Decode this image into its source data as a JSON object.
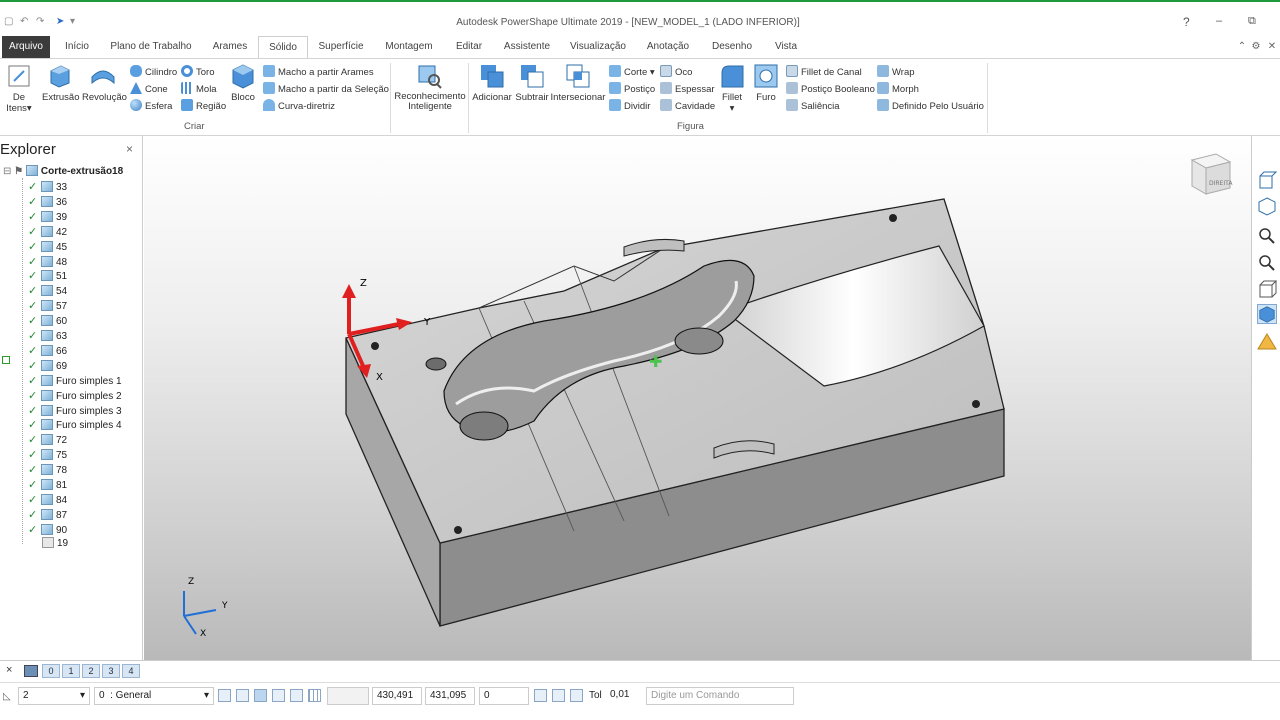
{
  "window": {
    "title": "Autodesk PowerShape Ultimate 2019 - [NEW_MODEL_1 (LADO INFERIOR)]",
    "help": "?",
    "minimize": "–",
    "maximize": "⧉",
    "close": "✕",
    "ribbon_collapse": "⌃",
    "ribbon_settings": "⚙",
    "ribbon_close": "✕"
  },
  "tabs": [
    "Arquivo",
    "Início",
    "Plano de Trabalho",
    "Arames",
    "Sólido",
    "Superfície",
    "Montagem",
    "Editar",
    "Assistente",
    "Visualização",
    "Anotação",
    "Desenho",
    "Vista"
  ],
  "active_tab": "Sólido",
  "ribbon": {
    "criar": {
      "label": "Criar",
      "de_itens": "De Itens",
      "extrusao": "Extrusão",
      "revolucao": "Revolução",
      "cilindro": "Cilindro",
      "cone": "Cone",
      "esfera": "Esfera",
      "toro": "Toro",
      "mola": "Mola",
      "regiao": "Região",
      "bloco": "Bloco",
      "macho_arames": "Macho a partir Arames",
      "macho_selecao": "Macho a partir da Seleção",
      "curva_diretriz": "Curva-diretriz"
    },
    "reconhecimento": "Reconhecimento Inteligente",
    "figura": {
      "label": "Figura",
      "adicionar": "Adicionar",
      "subtrair": "Subtrair",
      "intersecionar": "Intersecionar",
      "corte": "Corte",
      "postico": "Postiço",
      "dividir": "Dividir",
      "oco": "Oco",
      "espessar": "Espessar",
      "cavidade": "Cavidade",
      "fillet": "Fillet",
      "furo": "Furo",
      "fillet_canal": "Fillet de Canal",
      "postico_booleano": "Postiço Booleano",
      "saliencia": "Saliência",
      "wrap": "Wrap",
      "morph": "Morph",
      "definido_usuario": "Definido Pelo Usuário"
    }
  },
  "explorer": {
    "title": "Explorer",
    "close": "×",
    "root": "Corte-extrusão18",
    "items": [
      "33",
      "36",
      "39",
      "42",
      "45",
      "48",
      "51",
      "54",
      "57",
      "60",
      "63",
      "66",
      "69",
      "Furo simples 1",
      "Furo simples 2",
      "Furo simples 3",
      "Furo simples 4",
      "72",
      "75",
      "78",
      "81",
      "84",
      "87",
      "90"
    ],
    "last_item": "19"
  },
  "viewport": {
    "axis_z": "Z",
    "axis_y": "Y",
    "axis_x": "X",
    "mini_z": "Z",
    "mini_y": "Y",
    "mini_x": "X",
    "viewcube_label": "DIREITA"
  },
  "layers": {
    "close": "×",
    "items": [
      "0",
      "1",
      "2",
      "3",
      "4"
    ]
  },
  "status": {
    "level": "2",
    "layer": "0",
    "layer_name": ": General",
    "x": "430,491",
    "y": "431,095",
    "z": "0",
    "tol_label": "Tol",
    "tol": "0,01",
    "command_placeholder": "Digite um Comando"
  },
  "colors": {
    "accent": "#1e9a3c",
    "file_tab": "#3b3b3b",
    "icon_blue": "#4a90d9",
    "part_gray": "#8a8a8a",
    "axis_red": "#e02020",
    "axis_blue": "#1f6fd6"
  }
}
